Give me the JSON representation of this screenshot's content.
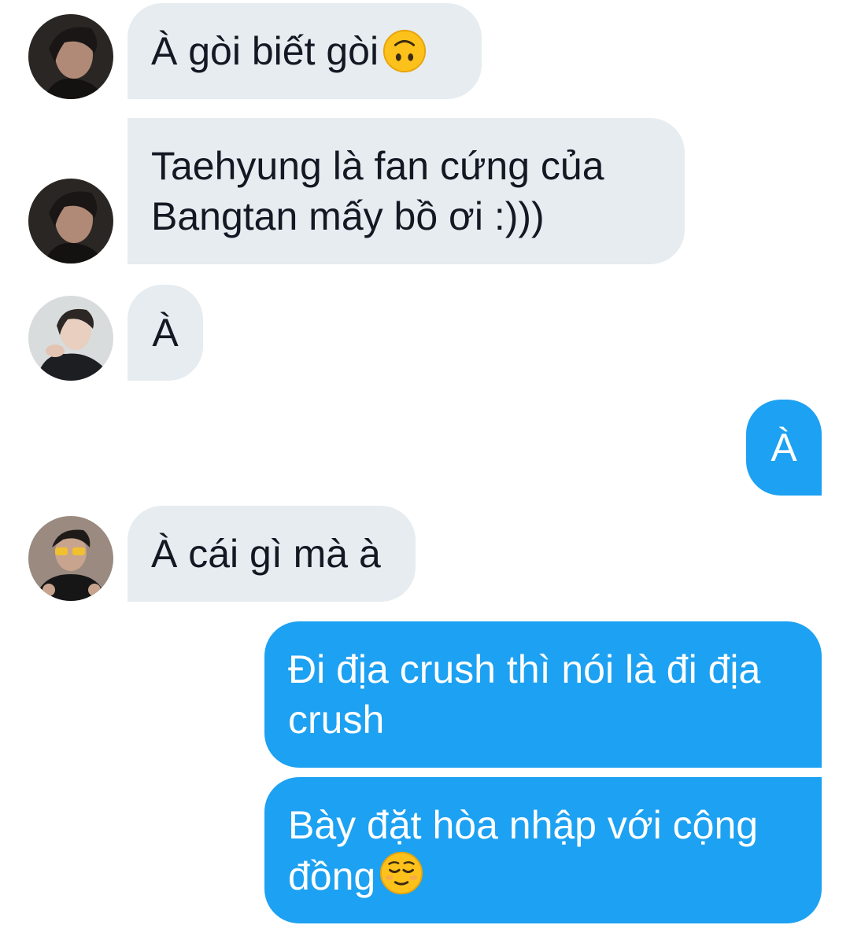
{
  "conversation": {
    "messages": [
      {
        "sender": "incoming",
        "avatar": "avatar-taehyung",
        "text": "À gòi biết gòi",
        "emoji": "upside-down-face-emoji"
      },
      {
        "sender": "incoming",
        "avatar": "avatar-taehyung",
        "text": "Taehyung là fan cứng của\nBangtan mấy bồ ơi :)))"
      },
      {
        "sender": "incoming",
        "avatar": "avatar-suga",
        "text": "À"
      },
      {
        "sender": "outgoing",
        "text": "À"
      },
      {
        "sender": "incoming",
        "avatar": "avatar-hoseok",
        "text": "À cái gì mà à"
      },
      {
        "sender": "outgoing",
        "text": "Đi địa crush thì nói là đi địa\ncrush"
      },
      {
        "sender": "outgoing",
        "text": "Bày đặt hòa nhập với cộng\nđồng",
        "emoji": "relieved-face-emoji"
      }
    ]
  },
  "colors": {
    "incoming_bubble": "#e6ecf0",
    "outgoing_bubble": "#1da1f2",
    "incoming_text": "#141823",
    "outgoing_text": "#ffffff"
  }
}
